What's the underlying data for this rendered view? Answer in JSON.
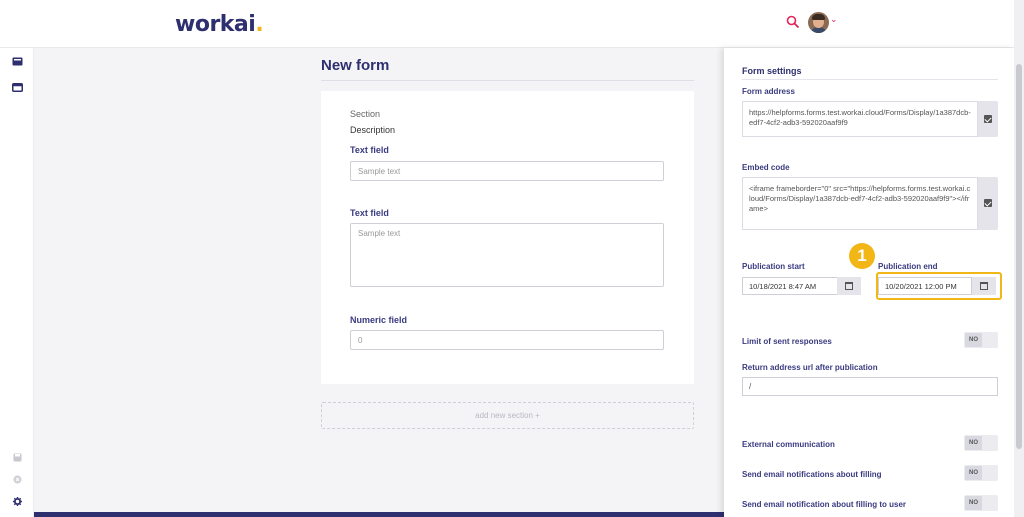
{
  "header": {
    "logo_text": "workai",
    "logo_dot": ".",
    "search_icon": "search-icon",
    "avatar": "user-avatar"
  },
  "sidebar": {
    "icons": [
      "card-icon",
      "window-icon",
      "save-icon",
      "close-circle-icon",
      "gear-icon"
    ]
  },
  "main": {
    "title": "New form",
    "section_label": "Section",
    "description_label": "Description",
    "fields": [
      {
        "label": "Text field",
        "placeholder": "Sample text"
      },
      {
        "label": "Text field",
        "placeholder": "Sample text"
      },
      {
        "label": "Numeric field",
        "placeholder": "0"
      }
    ],
    "add_section_label": "add new section +"
  },
  "panel": {
    "title": "Form settings",
    "form_address_label": "Form address",
    "form_address_value": "https://helpforms.forms.test.workai.cloud/Forms/Display/1a387dcb-edf7-4cf2-adb3-592020aaf9f9",
    "embed_code_label": "Embed code",
    "embed_code_value": "<iframe frameborder=\"0\" src=\"https://helpforms.forms.test.workai.cloud/Forms/Display/1a387dcb-edf7-4cf2-adb3-592020aaf9f9\"></iframe>",
    "publication_start_label": "Publication start",
    "publication_start_value": "10/18/2021 8:47 AM",
    "publication_end_label": "Publication end",
    "publication_end_value": "10/20/2021 12:00 PM",
    "limit_label": "Limit of sent responses",
    "return_url_label": "Return address url after publication",
    "return_url_value": "/",
    "external_comm_label": "External communication",
    "email_notif_label": "Send email notifications about filling",
    "email_user_label": "Send email notification about filling to user",
    "toggle_no": "NO"
  },
  "annotation": {
    "step_number": "1"
  },
  "colors": {
    "brand_navy": "#2e2f6e",
    "accent_yellow": "#f2b716",
    "search_red": "#e2245a"
  }
}
